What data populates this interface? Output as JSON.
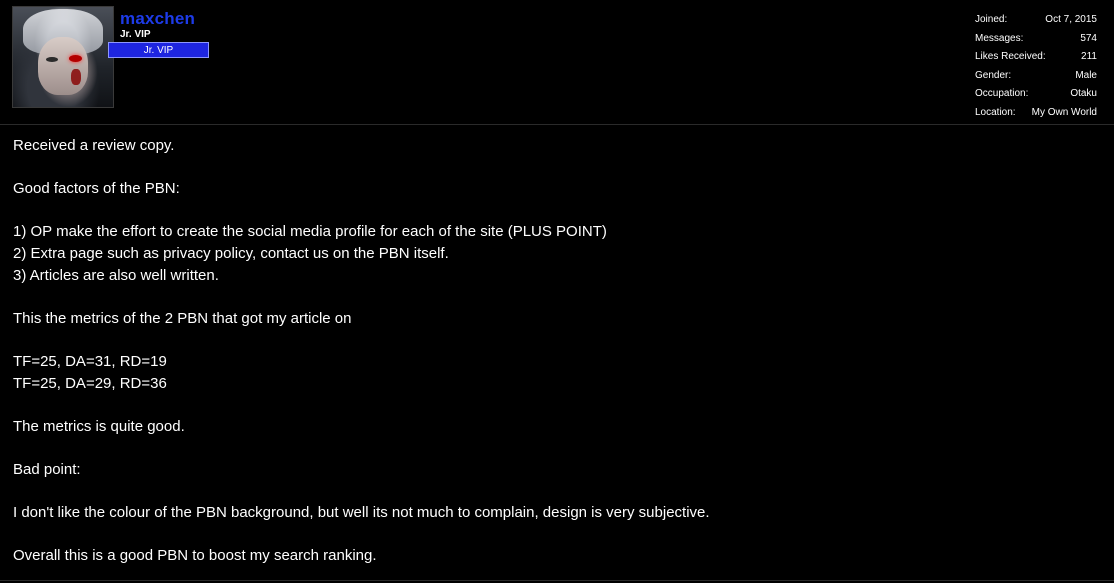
{
  "user": {
    "username": "maxchen",
    "user_title": "Jr. VIP",
    "role_banner": "Jr. VIP"
  },
  "stats": [
    {
      "label": "Joined:",
      "value": "Oct 7, 2015"
    },
    {
      "label": "Messages:",
      "value": "574"
    },
    {
      "label": "Likes Received:",
      "value": "211"
    },
    {
      "label": "Gender:",
      "value": "Male"
    },
    {
      "label": "Occupation:",
      "value": "Otaku"
    },
    {
      "label": "Location:",
      "value": "My Own World"
    }
  ],
  "post": {
    "lines": [
      "Received a review copy.",
      "",
      "Good factors of the PBN:",
      "",
      "1) OP make the effort to create the social media profile for each of the site (PLUS POINT)",
      "2) Extra page such as privacy policy, contact us on the PBN itself.",
      "3) Articles are also well written.",
      "",
      "This the metrics of the 2 PBN that got my article on",
      "",
      "TF=25, DA=31, RD=19",
      "TF=25, DA=29, RD=36",
      "",
      "The metrics is quite good.",
      "",
      "Bad point:",
      "",
      "I don't like the colour of the PBN background, but well its not much to complain, design is very subjective.",
      "",
      "Overall this is a good PBN to boost my search ranking."
    ]
  },
  "colors": {
    "background": "#000000",
    "username": "#1d3be8",
    "role_banner": "#1e25e0"
  }
}
